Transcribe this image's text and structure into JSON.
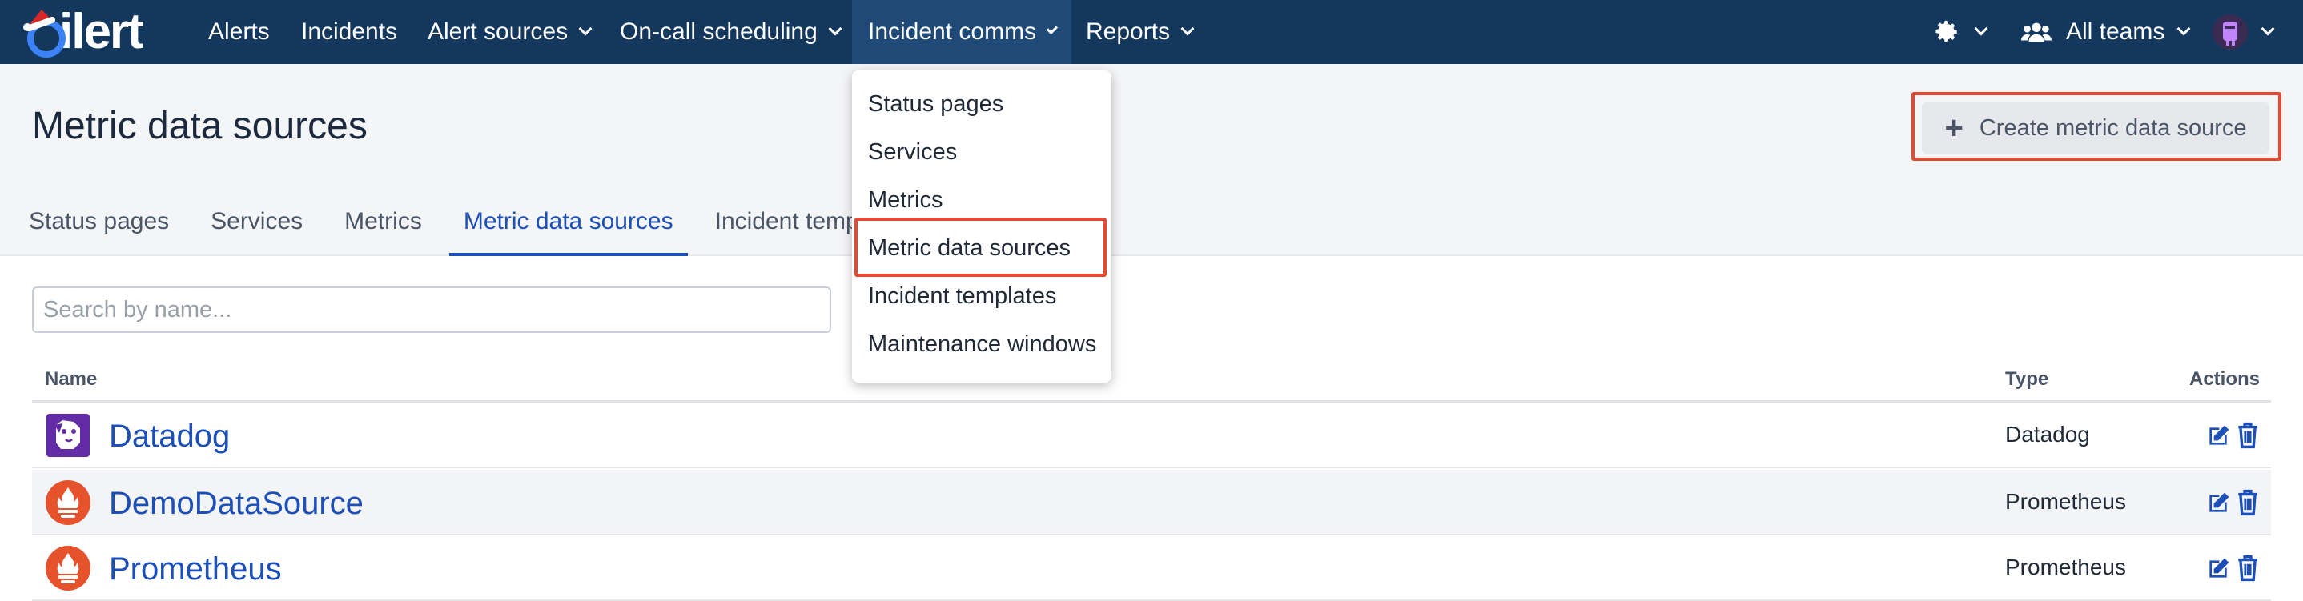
{
  "nav": {
    "logo": "ilert",
    "items": [
      {
        "label": "Alerts"
      },
      {
        "label": "Incidents"
      },
      {
        "label": "Alert sources"
      },
      {
        "label": "On-call scheduling"
      },
      {
        "label": "Incident comms"
      },
      {
        "label": "Reports"
      }
    ],
    "teams_label": "All teams",
    "settings_icon": "gear-icon",
    "teams_icon": "users-icon"
  },
  "header": {
    "title": "Metric data sources",
    "create_button": "Create metric data source"
  },
  "tabs": [
    {
      "label": "Status pages"
    },
    {
      "label": "Services"
    },
    {
      "label": "Metrics"
    },
    {
      "label": "Metric data sources"
    },
    {
      "label": "Incident templ"
    }
  ],
  "search": {
    "placeholder": "Search by name..."
  },
  "table": {
    "columns": {
      "name": "Name",
      "type": "Type",
      "actions": "Actions"
    },
    "rows": [
      {
        "name": "Datadog",
        "type": "Datadog",
        "icon": "datadog-icon"
      },
      {
        "name": "DemoDataSource",
        "type": "Prometheus",
        "icon": "prometheus-icon"
      },
      {
        "name": "Prometheus",
        "type": "Prometheus",
        "icon": "prometheus-icon"
      }
    ]
  },
  "dropdown": {
    "items": [
      {
        "label": "Status pages"
      },
      {
        "label": "Services"
      },
      {
        "label": "Metrics"
      },
      {
        "label": "Metric data sources"
      },
      {
        "label": "Incident templates"
      },
      {
        "label": "Maintenance windows"
      }
    ]
  },
  "colors": {
    "nav_bg": "#14375e",
    "accent": "#1d4fb8",
    "highlight": "#e24a33",
    "prometheus": "#e6522c",
    "datadog": "#632ca6"
  }
}
